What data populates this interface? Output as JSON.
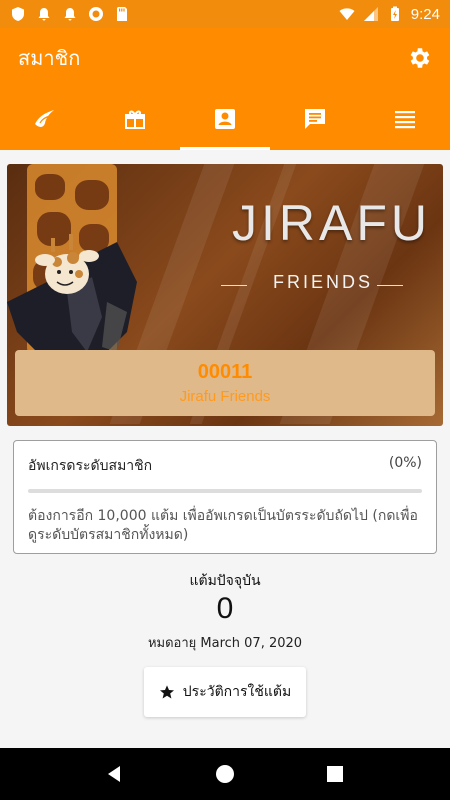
{
  "status_bar": {
    "time": "9:24"
  },
  "app_bar": {
    "title": "สมาชิก",
    "settings_icon": "gear-icon"
  },
  "tabs": [
    {
      "icon": "bird-logo-icon",
      "active": false
    },
    {
      "icon": "gift-icon",
      "active": false
    },
    {
      "icon": "member-card-icon",
      "active": true
    },
    {
      "icon": "message-icon",
      "active": false
    },
    {
      "icon": "menu-icon",
      "active": false
    }
  ],
  "banner": {
    "brand": "JIRAFU",
    "brand_sub": "FRIENDS",
    "member_number": "00011",
    "member_tier": "Jirafu Friends"
  },
  "upgrade": {
    "title": "อัพเกรดระดับสมาชิก",
    "percent_text": "(0%)",
    "progress": 0,
    "description": "ต้องการอีก 10,000 แต้ม เพื่ออัพเกรดเป็นบัตรระดับถัดไป (กดเพื่อดูระดับบัตรสมาชิกทั้งหมด)"
  },
  "points": {
    "label": "แต้มปัจจุบัน",
    "value": "0",
    "expiry": "หมดอายุ March 07, 2020"
  },
  "history_button": {
    "label": "ประวัติการใช้แต้ม",
    "icon": "star-icon"
  },
  "colors": {
    "primary": "#ff8c00",
    "status_bar": "#f28c0c",
    "card": "#e0b98a"
  }
}
